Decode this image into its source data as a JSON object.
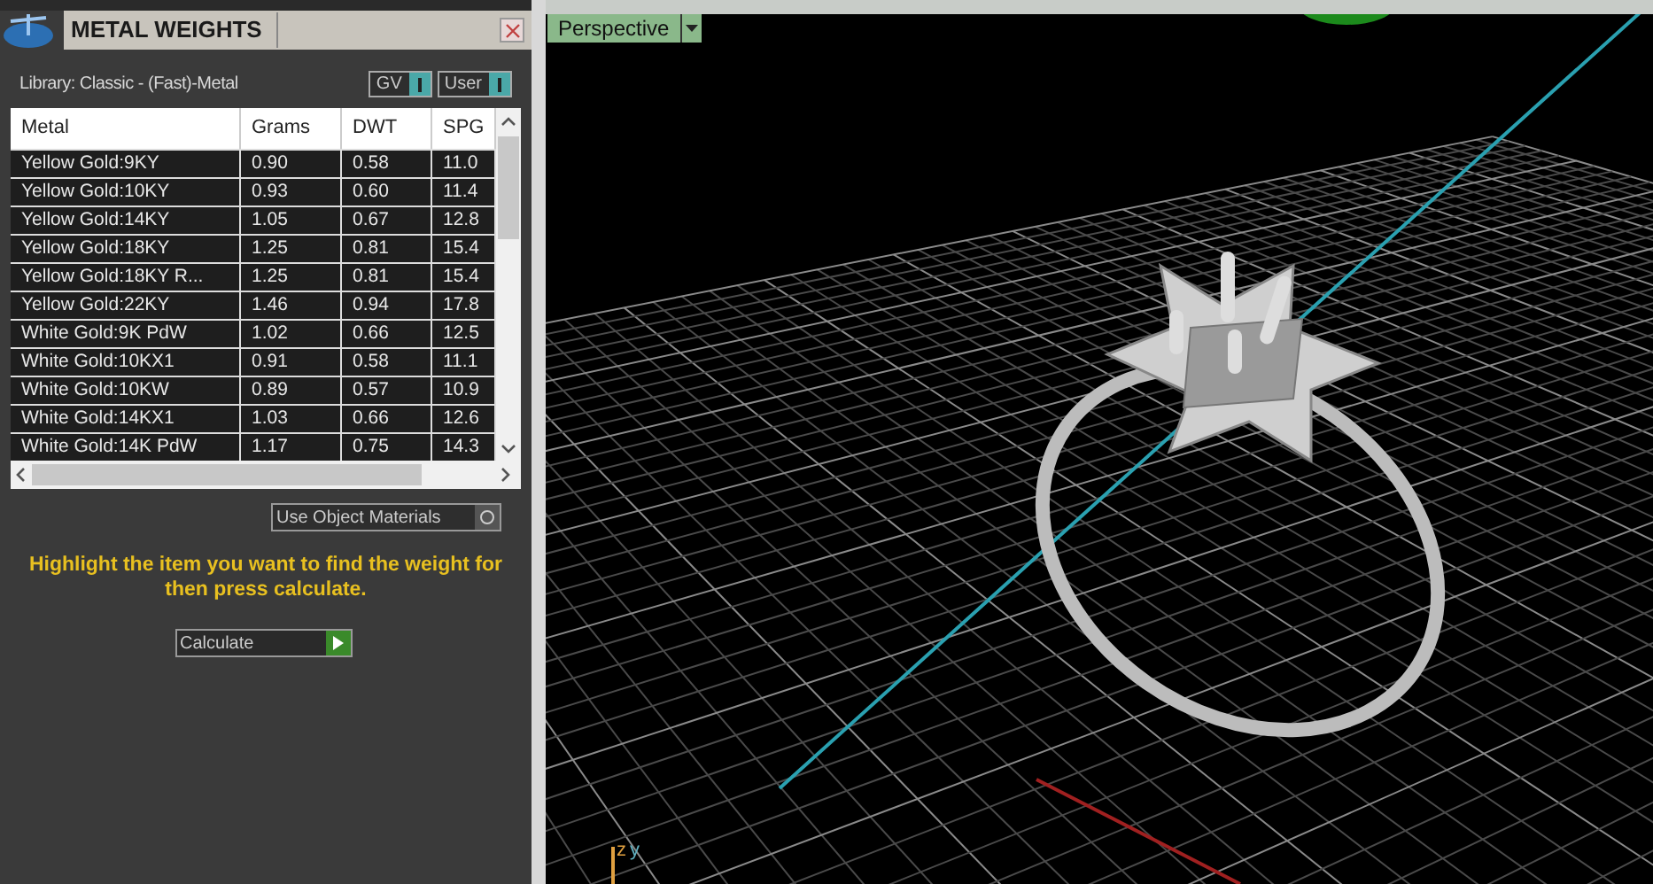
{
  "panel": {
    "title": "METAL WEIGHTS",
    "library": "Library: Classic - (Fast)-Metal",
    "toggles": [
      {
        "label": "GV",
        "on": true
      },
      {
        "label": "User",
        "on": true
      }
    ]
  },
  "table": {
    "columns": [
      "Metal",
      "Grams",
      "DWT",
      "SPG"
    ],
    "rows": [
      {
        "cells": [
          "Yellow Gold:9KY",
          "0.90",
          "0.58",
          "11.0"
        ]
      },
      {
        "cells": [
          "Yellow Gold:10KY",
          "0.93",
          "0.60",
          "11.4"
        ]
      },
      {
        "cells": [
          "Yellow Gold:14KY",
          "1.05",
          "0.67",
          "12.8"
        ]
      },
      {
        "cells": [
          "Yellow Gold:18KY",
          "1.25",
          "0.81",
          "15.4"
        ]
      },
      {
        "cells": [
          "Yellow Gold:18KY R...",
          "1.25",
          "0.81",
          "15.4"
        ]
      },
      {
        "cells": [
          "Yellow Gold:22KY",
          "1.46",
          "0.94",
          "17.8"
        ]
      },
      {
        "cells": [
          "White Gold:9K PdW",
          "1.02",
          "0.66",
          "12.5"
        ]
      },
      {
        "cells": [
          "White Gold:10KX1",
          "0.91",
          "0.58",
          "11.1"
        ]
      },
      {
        "cells": [
          "White Gold:10KW",
          "0.89",
          "0.57",
          "10.9"
        ]
      },
      {
        "cells": [
          "White Gold:14KX1",
          "1.03",
          "0.66",
          "12.6"
        ]
      },
      {
        "cells": [
          "White Gold:14K PdW",
          "1.17",
          "0.75",
          "14.3"
        ]
      }
    ]
  },
  "use_object_materials": {
    "label": "Use Object Materials",
    "checked": false
  },
  "message": "Highlight the item you want to find the weight for then press calculate.",
  "calculate_button": "Calculate",
  "viewport": {
    "view_menu": "Perspective",
    "axes": [
      {
        "label": "z",
        "color": "#e0a040"
      },
      {
        "label": "y",
        "color": "#60b0c0"
      }
    ]
  }
}
